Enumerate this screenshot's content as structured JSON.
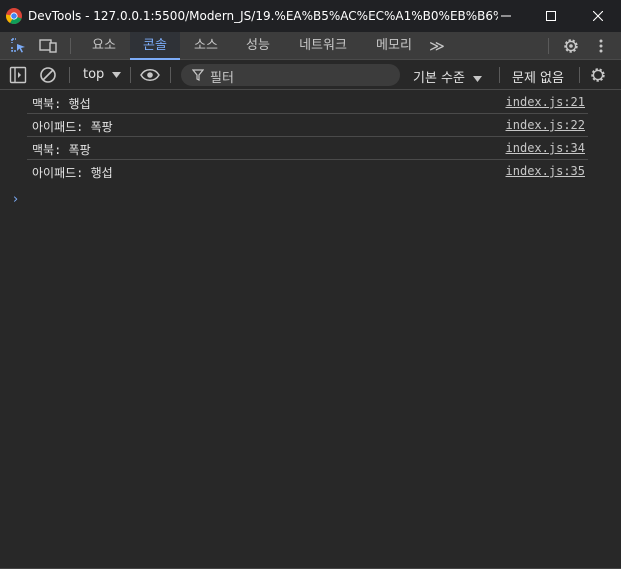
{
  "window": {
    "title": "DevTools - 127.0.0.1:5500/Modern_JS/19.%EA%B5%AC%EC%A1%B0%EB%B6%84...",
    "minimize_icon": "minimize-icon",
    "maximize_icon": "maximize-icon",
    "close_icon": "close-icon"
  },
  "tabs": {
    "items": [
      {
        "label": "요소"
      },
      {
        "label": "콘솔"
      },
      {
        "label": "소스"
      },
      {
        "label": "성능"
      },
      {
        "label": "네트워크"
      },
      {
        "label": "메모리"
      }
    ],
    "active": "콘솔",
    "more_icon": "chevron-double-right-icon",
    "more_glyph": "≫"
  },
  "toolbar": {
    "context": "top",
    "filter_placeholder": "필터",
    "levels": "기본 수준",
    "issues": "문제 없음"
  },
  "console": {
    "messages": [
      {
        "text": "맥북: 행섭",
        "source": "index.js:21"
      },
      {
        "text": "아이패드: 폭팡",
        "source": "index.js:22"
      },
      {
        "text": "맥북: 폭팡",
        "source": "index.js:34"
      },
      {
        "text": "아이패드: 행섭",
        "source": "index.js:35"
      }
    ],
    "prompt": "›"
  },
  "colors": {
    "accent": "#7cacf8",
    "background": "#282828",
    "titlebar": "#202124",
    "tabbar": "#3c3c3c"
  }
}
